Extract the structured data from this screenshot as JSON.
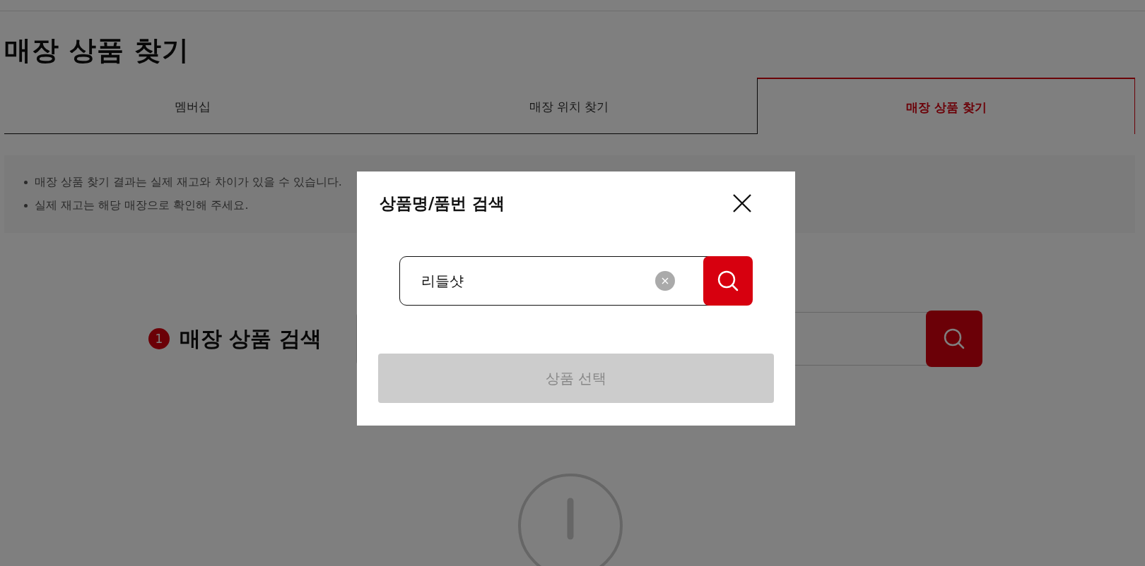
{
  "page": {
    "title": "매장 상품 찾기"
  },
  "tabs": [
    {
      "label": "멤버십",
      "selected": false
    },
    {
      "label": "매장 위치 찾기",
      "selected": false
    },
    {
      "label": "매장 상품 찾기",
      "selected": true
    }
  ],
  "notices": [
    "매장 상품 찾기 결과는 실제 재고와 차이가 있을 수 있습니다.",
    "실제 재고는 해당 매장으로 확인해 주세요."
  ],
  "search_section": {
    "step": "1",
    "title": "매장 상품 검색"
  },
  "modal": {
    "title": "상품명/품번 검색",
    "search": {
      "value": "리들샷"
    },
    "select_button": {
      "label": "상품 선택",
      "disabled": true
    }
  }
}
